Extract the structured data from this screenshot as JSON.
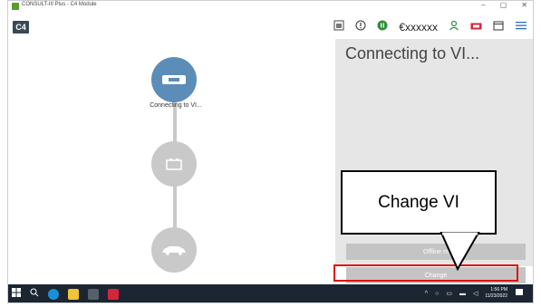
{
  "window": {
    "title": "CONSULT-III Plus - C4 Module",
    "minimize": "–",
    "maximize": "▢",
    "close": "✕"
  },
  "header": {
    "logo": "C4",
    "account": "€xxxxxx"
  },
  "left": {
    "step1_label": "Connecting to VI..."
  },
  "right": {
    "title": "Connecting to VI...",
    "offline_button": "Offline m",
    "change_button": "Change"
  },
  "callout": {
    "text": "Change VI"
  },
  "taskbar": {
    "time": "1:56 PM",
    "date": "11/23/2022"
  },
  "colors": {
    "active_node": "#5b8db8",
    "inactive_node": "#c9c9c9",
    "highlight": "#e01010",
    "taskbar": "#1c2632"
  }
}
